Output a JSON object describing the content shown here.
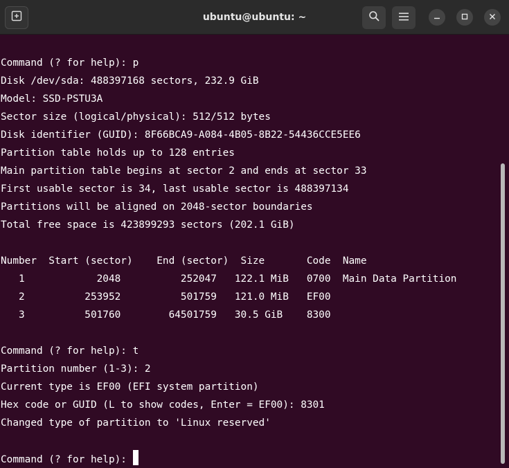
{
  "window": {
    "title": "ubuntu@ubuntu: ~"
  },
  "icons": {
    "new_tab": "new-tab-icon",
    "search": "search-icon",
    "menu": "hamburger-menu-icon",
    "minimize": "minimize-icon",
    "maximize": "maximize-icon",
    "close": "close-icon"
  },
  "colors": {
    "terminal_bg": "#300a24",
    "titlebar_bg": "#2b2b2b",
    "text": "#ffffff"
  },
  "terminal": {
    "lines": [
      "Command (? for help): p",
      "Disk /dev/sda: 488397168 sectors, 232.9 GiB",
      "Model: SSD-PSTU3A",
      "Sector size (logical/physical): 512/512 bytes",
      "Disk identifier (GUID): 8F66BCA9-A084-4B05-8B22-54436CCE5EE6",
      "Partition table holds up to 128 entries",
      "Main partition table begins at sector 2 and ends at sector 33",
      "First usable sector is 34, last usable sector is 488397134",
      "Partitions will be aligned on 2048-sector boundaries",
      "Total free space is 423899293 sectors (202.1 GiB)",
      "",
      "Number  Start (sector)    End (sector)  Size       Code  Name",
      "   1            2048          252047   122.1 MiB   0700  Main Data Partition",
      "   2          253952          501759   121.0 MiB   EF00",
      "   3          501760        64501759   30.5 GiB    8300",
      "",
      "Command (? for help): t",
      "Partition number (1-3): 2",
      "Current type is EF00 (EFI system partition)",
      "Hex code or GUID (L to show codes, Enter = EF00): 8301",
      "Changed type of partition to 'Linux reserved'",
      "",
      "Command (? for help):"
    ]
  }
}
